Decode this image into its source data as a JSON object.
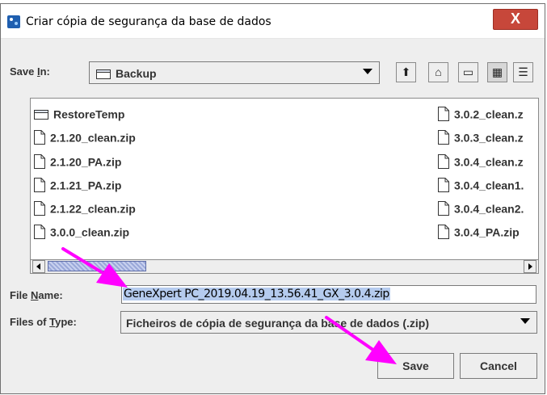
{
  "window": {
    "title": "Criar cópia de segurança da base de dados",
    "close_glyph": "X"
  },
  "save_in": {
    "label_before": "Save ",
    "label_mnemonic": "I",
    "label_after": "n:",
    "value": "Backup",
    "icon": "folder-icon"
  },
  "toolbar": {
    "buttons": [
      {
        "name": "up-one-level-icon",
        "glyph": "⬆"
      },
      {
        "name": "home-icon",
        "glyph": "⌂"
      },
      {
        "name": "new-folder-icon",
        "glyph": "▭"
      },
      {
        "name": "list-view-icon",
        "glyph": "▦"
      },
      {
        "name": "details-view-icon",
        "glyph": "☰"
      }
    ]
  },
  "files": {
    "left": [
      {
        "name": "RestoreTemp",
        "type": "folder"
      },
      {
        "name": "2.1.20_clean.zip",
        "type": "file"
      },
      {
        "name": "2.1.20_PA.zip",
        "type": "file"
      },
      {
        "name": "2.1.21_PA.zip",
        "type": "file"
      },
      {
        "name": "2.1.22_clean.zip",
        "type": "file"
      },
      {
        "name": "3.0.0_clean.zip",
        "type": "file"
      }
    ],
    "right": [
      {
        "name": "3.0.2_clean.z",
        "type": "file"
      },
      {
        "name": "3.0.3_clean.z",
        "type": "file"
      },
      {
        "name": "3.0.4_clean.z",
        "type": "file"
      },
      {
        "name": "3.0.4_clean1.",
        "type": "file"
      },
      {
        "name": "3.0.4_clean2.",
        "type": "file"
      },
      {
        "name": "3.0.4_PA.zip",
        "type": "file"
      }
    ]
  },
  "file_name": {
    "label_before": "File ",
    "label_mnemonic": "N",
    "label_after": "ame:",
    "value": "GeneXpert PC_2019.04.19_13.56.41_GX_3.0.4.zip"
  },
  "files_of_type": {
    "label_before": "Files of ",
    "label_mnemonic": "T",
    "label_after": "ype:",
    "value": "Ficheiros de cópia de segurança da base de dados (.zip)"
  },
  "buttons": {
    "save": "Save",
    "cancel": "Cancel"
  },
  "colors": {
    "annotation_arrow": "#ff00ff",
    "selection": "#b5cbee",
    "close_button": "#c7473a"
  }
}
